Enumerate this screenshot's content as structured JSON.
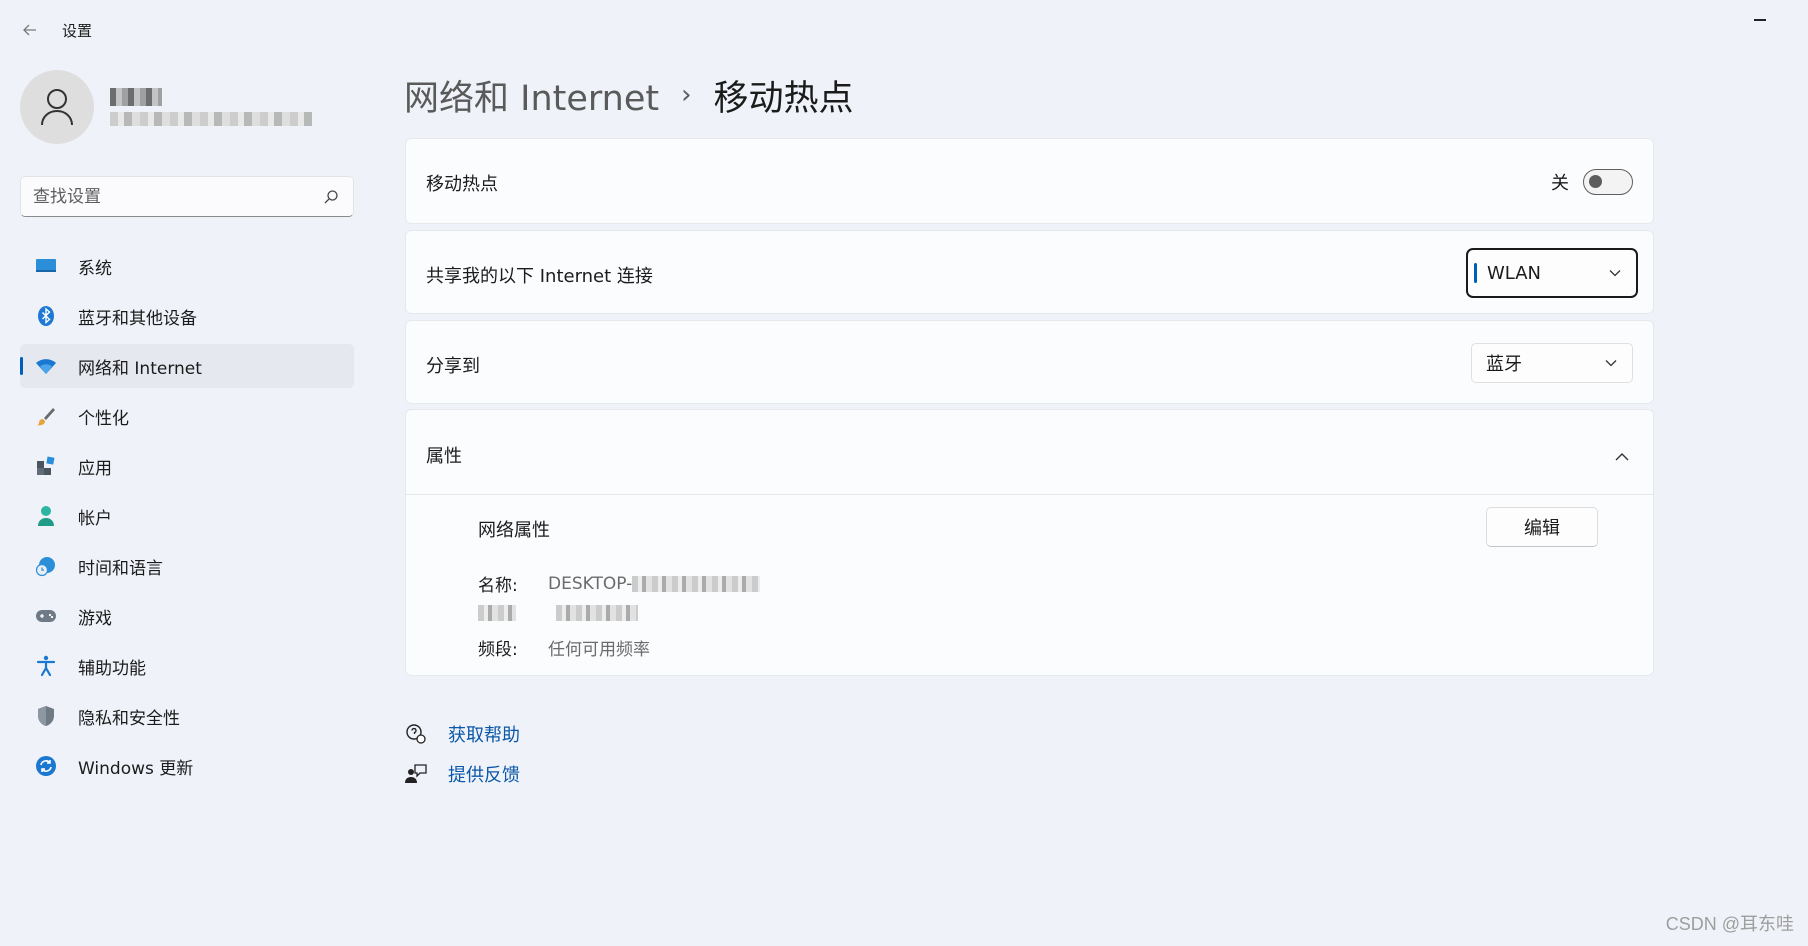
{
  "titlebar": {
    "title": "设置",
    "back_icon": "arrow-left-icon",
    "minimize_icon": "minimize-icon"
  },
  "search": {
    "placeholder": "查找设置",
    "value": ""
  },
  "nav": {
    "items": [
      {
        "label": "系统",
        "icon": "system-display-icon"
      },
      {
        "label": "蓝牙和其他设备",
        "icon": "bluetooth-icon"
      },
      {
        "label": "网络和 Internet",
        "icon": "wifi-icon",
        "active": true
      },
      {
        "label": "个性化",
        "icon": "brush-icon"
      },
      {
        "label": "应用",
        "icon": "apps-icon"
      },
      {
        "label": "帐户",
        "icon": "account-icon"
      },
      {
        "label": "时间和语言",
        "icon": "globe-clock-icon"
      },
      {
        "label": "游戏",
        "icon": "gamepad-icon"
      },
      {
        "label": "辅助功能",
        "icon": "accessibility-icon"
      },
      {
        "label": "隐私和安全性",
        "icon": "shield-icon"
      },
      {
        "label": "Windows 更新",
        "icon": "update-icon"
      }
    ]
  },
  "breadcrumb": {
    "parent": "网络和 Internet",
    "separator": "›",
    "current": "移动热点"
  },
  "hotspot": {
    "label": "移动热点",
    "state_text": "关",
    "enabled": false
  },
  "share_from": {
    "label": "共享我的以下 Internet 连接",
    "value": "WLAN"
  },
  "share_to": {
    "label": "分享到",
    "value": "蓝牙"
  },
  "properties": {
    "label": "属性",
    "expanded": true,
    "network_props_label": "网络属性",
    "edit_label": "编辑",
    "name_key": "名称:",
    "name_value": "DESKTOP-",
    "password_value": "",
    "band_key": "频段:",
    "band_value": "任何可用频率"
  },
  "links": {
    "help": "获取帮助",
    "feedback": "提供反馈"
  },
  "colors": {
    "accent": "#005fb8",
    "link": "#0b57a8",
    "background": "#eff3f9"
  },
  "watermark": "CSDN @耳东哇"
}
